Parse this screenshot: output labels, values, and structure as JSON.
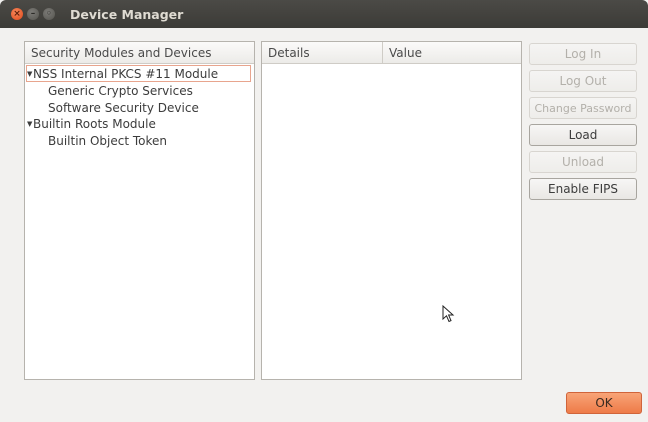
{
  "window": {
    "title": "Device Manager"
  },
  "tree": {
    "header": "Security Modules and Devices",
    "items": [
      {
        "label": "NSS Internal PKCS #11 Module",
        "expanded": true,
        "level": 0,
        "selected": true
      },
      {
        "label": "Generic Crypto Services",
        "level": 1
      },
      {
        "label": "Software Security Device",
        "level": 1
      },
      {
        "label": "Builtin Roots Module",
        "expanded": true,
        "level": 0
      },
      {
        "label": "Builtin Object Token",
        "level": 1
      }
    ]
  },
  "details": {
    "col_details": "Details",
    "col_value": "Value"
  },
  "buttons": {
    "log_in": "Log In",
    "log_out": "Log Out",
    "change_password": "Change Password",
    "load": "Load",
    "unload": "Unload",
    "enable_fips": "Enable FIPS"
  },
  "ok": "OK",
  "colors": {
    "accent": "#ee7b48",
    "titlebar": "#3c3b37"
  }
}
